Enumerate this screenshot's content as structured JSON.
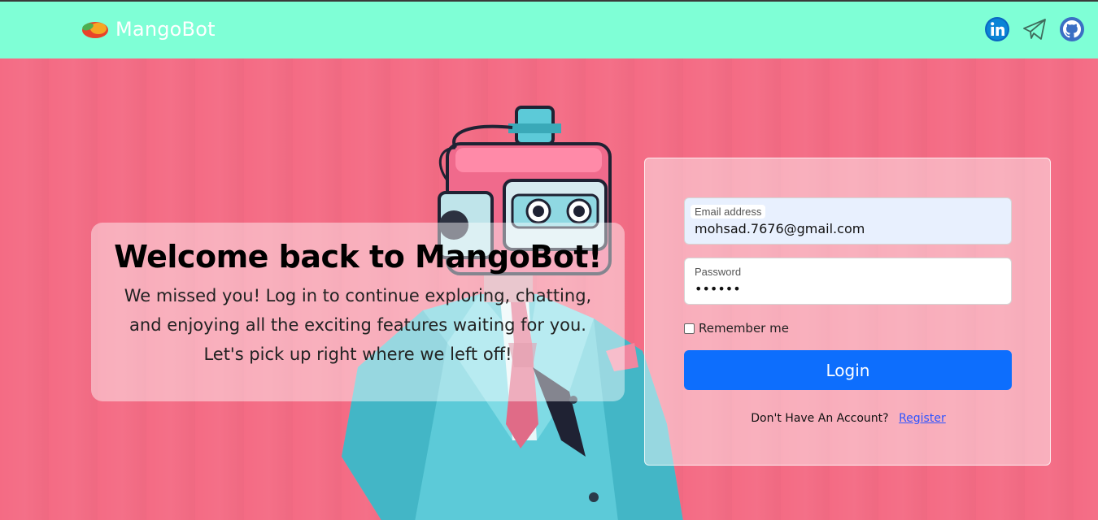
{
  "brand": {
    "name": "MangoBot",
    "logo_icon": "mango-logo-icon"
  },
  "nav": {
    "icons": [
      "linkedin-icon",
      "telegram-icon",
      "github-icon"
    ]
  },
  "welcome": {
    "title": "Welcome back to MangoBot!",
    "message": "We missed you! Log in to continue exploring, chatting, and enjoying all the exciting features waiting for you. Let's pick up right where we left off!"
  },
  "login": {
    "email_label": "Email address",
    "email_value": "mohsad.7676@gmail.com",
    "password_label": "Password",
    "password_value": "••••••",
    "remember_label": "Remember me",
    "remember_checked": false,
    "submit_label": "Login",
    "register_prompt": "Don't Have An Account?",
    "register_link": "Register"
  },
  "colors": {
    "navbar_bg": "#7fffd6",
    "page_bg": "#f46b84",
    "primary_button": "#0d6efd",
    "link": "#2f54ff"
  }
}
